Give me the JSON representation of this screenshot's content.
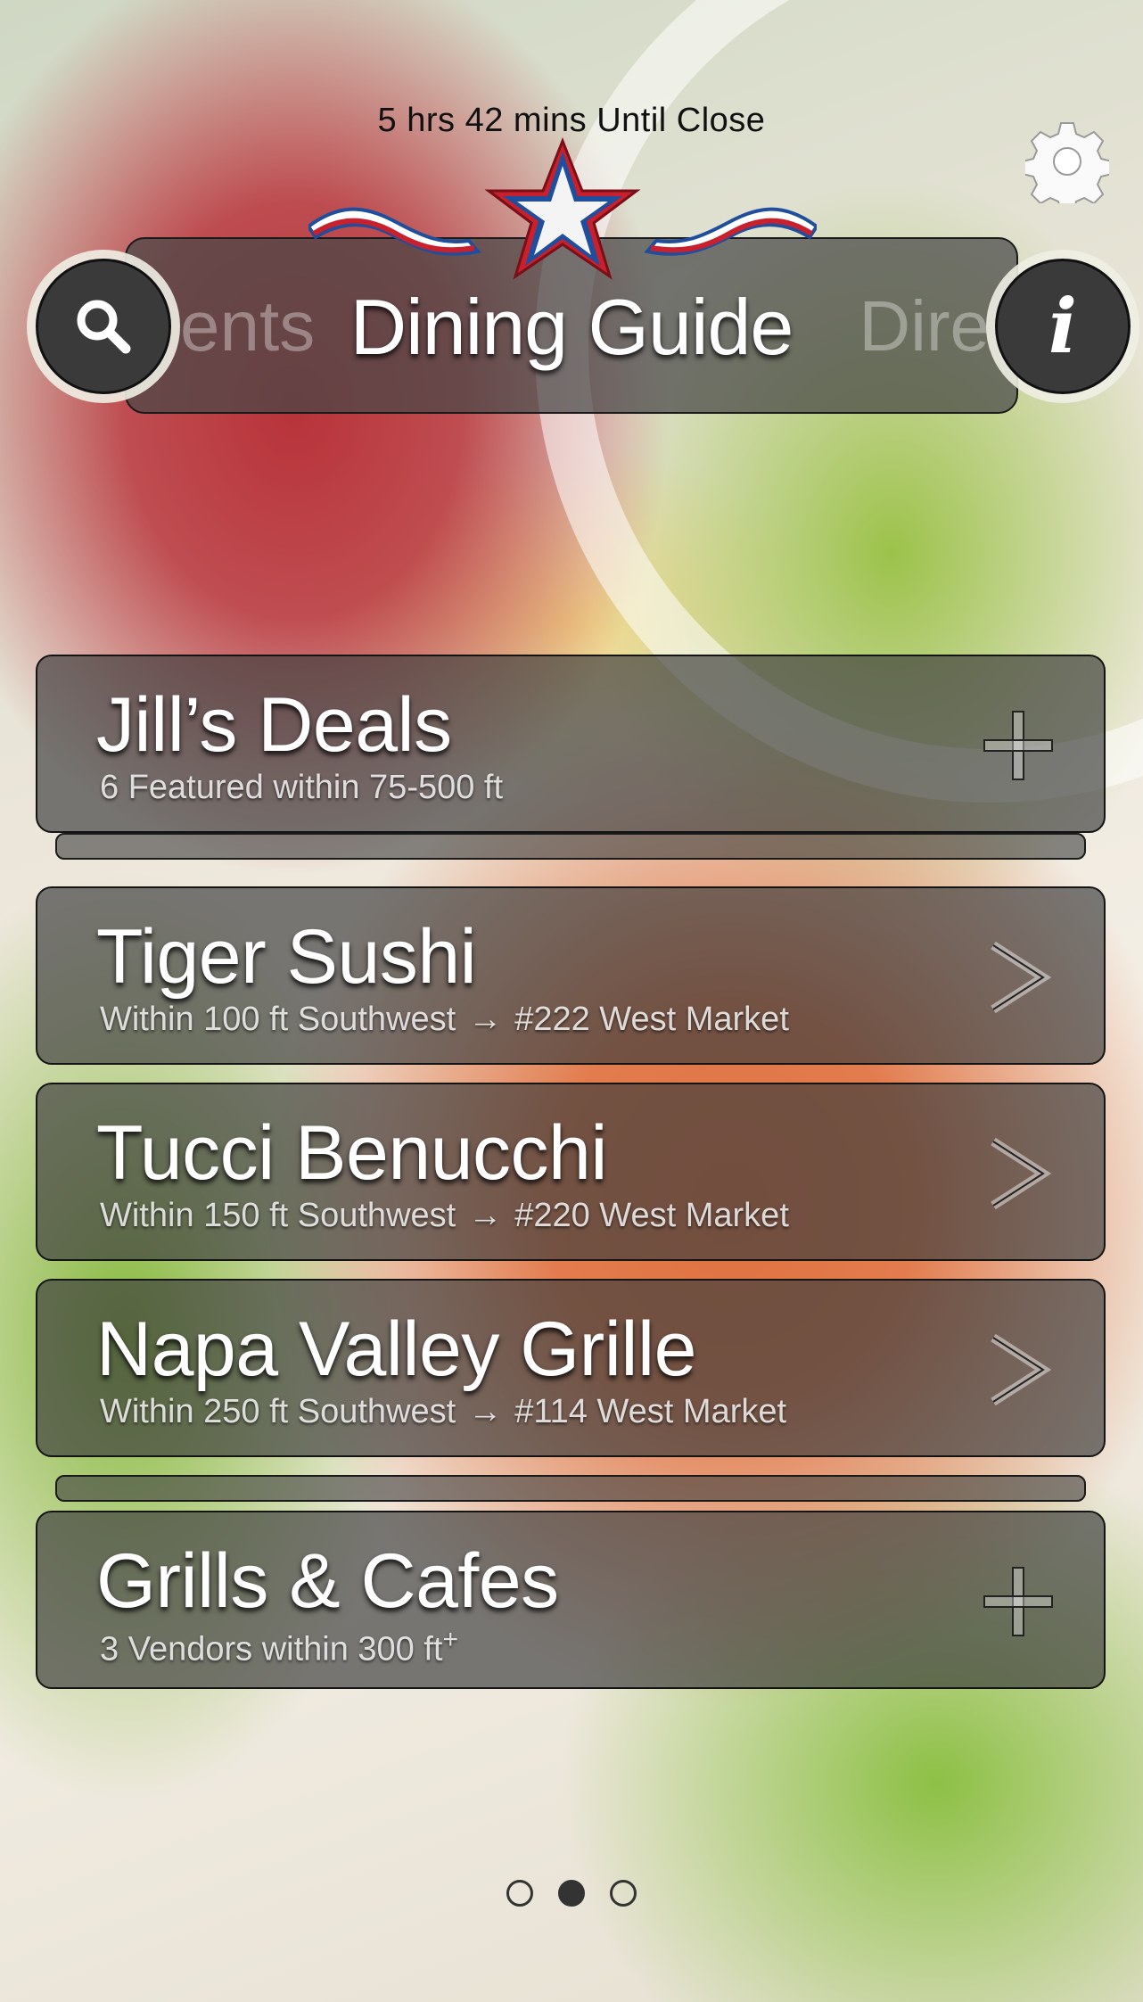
{
  "status": {
    "countdown": "5 hrs 42 mins Until Close"
  },
  "header": {
    "title": "Dining Guide",
    "prev_page_peek": "ents",
    "next_page_peek": "Dire",
    "search_icon": "search-icon",
    "info_icon": "info-icon",
    "settings_icon": "gear-icon",
    "logo_icon": "star-ribbon-logo"
  },
  "items": [
    {
      "title": "Jill’s Deals",
      "subtitle": "6 Featured within 75-500 ft",
      "icon": "plus-icon",
      "stacked": true
    },
    {
      "title": "Tiger Sushi",
      "distance": "Within 100 ft Southwest",
      "arrow": "→",
      "address": "#222 West Market",
      "icon": "chevron-right-icon"
    },
    {
      "title": "Tucci Benucchi",
      "distance": "Within 150 ft Southwest",
      "arrow": "→",
      "address": "#220 West Market",
      "icon": "chevron-right-icon"
    },
    {
      "title": "Napa Valley Grille",
      "distance": "Within 250 ft Southwest",
      "arrow": "→",
      "address": "#114 West Market",
      "icon": "chevron-right-icon"
    },
    {
      "title": "Grills & Cafes",
      "subtitle": "3 Vendors within 300 ft",
      "subtitle_sup": "+",
      "icon": "plus-icon",
      "stacked": true
    }
  ],
  "pager": {
    "count": 3,
    "active_index": 1
  },
  "colors": {
    "card_bg": "#3e3e3e",
    "star_blue": "#1f4e9c",
    "star_red": "#c8202c",
    "text": "#ffffff"
  }
}
